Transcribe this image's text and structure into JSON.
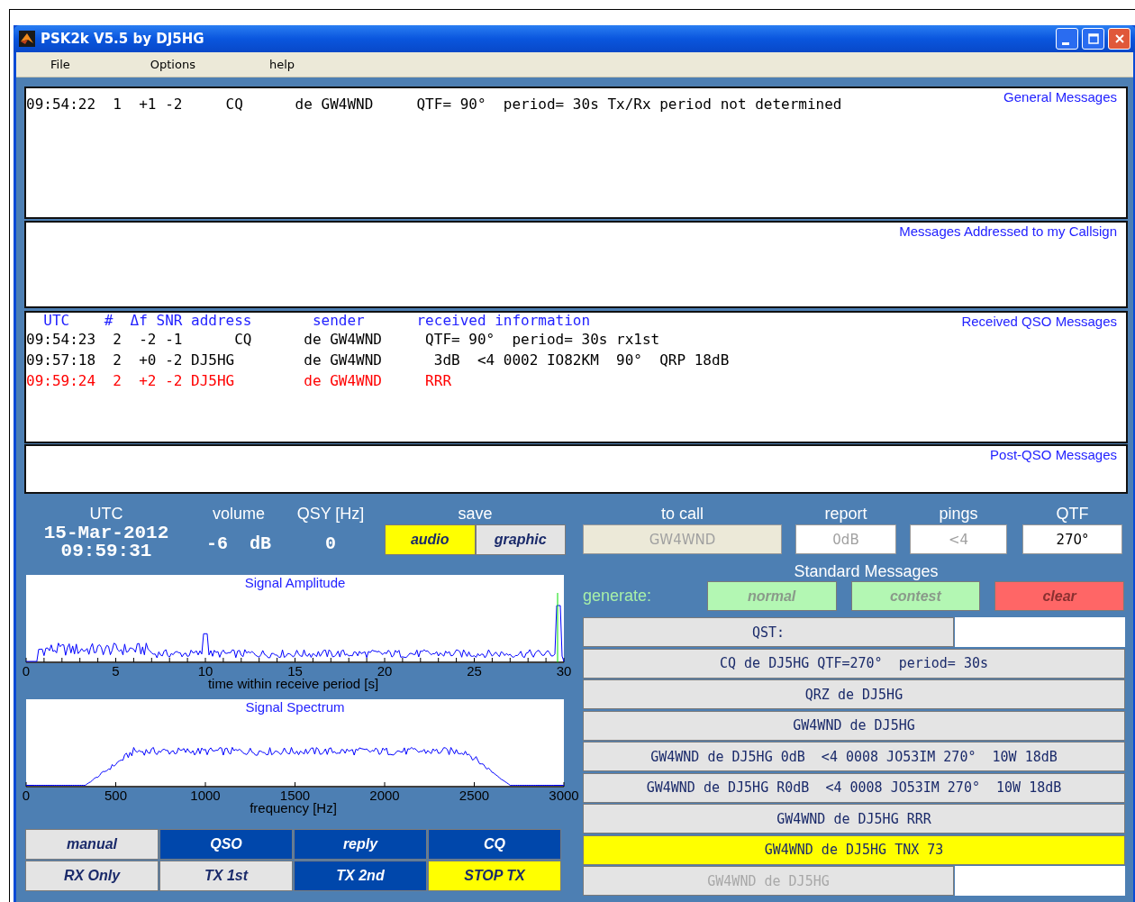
{
  "window": {
    "title": "PSK2k V5.5 by DJ5HG"
  },
  "menu": [
    {
      "label": "File"
    },
    {
      "label": "Options"
    },
    {
      "label": "help"
    }
  ],
  "message_panels": [
    {
      "title": "General Messages",
      "lines": [
        {
          "text": "09:54:22  1  +1 -2     CQ      de GW4WND     QTF= 90°  period= 30s Tx/Rx period not determined",
          "color": "#000000"
        }
      ]
    },
    {
      "title": "Messages Addressed to my Callsign"
    },
    {
      "title": "Received QSO Messages",
      "header": "  UTC    #  Δf SNR address       sender      received information",
      "lines": [
        {
          "text": "09:54:23  2  -2 -1      CQ      de GW4WND     QTF= 90°  period= 30s rx1st",
          "color": "#000000"
        },
        {
          "text": "09:57:18  2  +0 -2 DJ5HG        de GW4WND      3dB  <4 0002 IO82KM  90°  QRP 18dB",
          "color": "#000000"
        },
        {
          "text": "09:59:24  2  +2 -2 DJ5HG        de GW4WND     RRR",
          "color": "#ff0000"
        }
      ]
    },
    {
      "title": "Post-QSO Messages"
    }
  ],
  "clock": {
    "label": "UTC",
    "date": "15-Mar-2012",
    "time": "09:59:31"
  },
  "volume": {
    "label": "volume",
    "value": "-6  dB"
  },
  "qsy": {
    "label": "QSY [Hz]",
    "value": "0"
  },
  "save": {
    "label": "save",
    "buttons": [
      {
        "label": "audio",
        "selected": true
      },
      {
        "label": "graphic",
        "selected": false
      }
    ]
  },
  "amplitude_plot": {
    "title": "Signal Amplitude",
    "xlabel": "time within receive period [s]",
    "xticks": [
      "0",
      "5",
      "10",
      "15",
      "20",
      "25",
      "30"
    ]
  },
  "spectrum_plot": {
    "title": "Signal Spectrum",
    "xlabel": "frequency [Hz]",
    "xticks": [
      "0",
      "500",
      "1000",
      "1500",
      "2000",
      "2500",
      "3000"
    ]
  },
  "mode_buttons": [
    {
      "label": "manual",
      "kind": "toggle",
      "selected": false
    },
    {
      "label": "QSO",
      "kind": "toggle",
      "selected": true
    },
    {
      "label": "reply",
      "kind": "toggle",
      "selected": true
    },
    {
      "label": "CQ",
      "kind": "toggle",
      "selected": true
    },
    {
      "label": "RX Only",
      "kind": "toggle",
      "selected": false
    },
    {
      "label": "TX 1st",
      "kind": "toggle",
      "selected": false
    },
    {
      "label": "TX 2nd",
      "kind": "toggle",
      "selected": true
    },
    {
      "label": "STOP TX",
      "kind": "stop",
      "selected": false
    }
  ],
  "call_fields": [
    {
      "label": "to call",
      "value": "GW4WND",
      "kind": "readonly",
      "disabled": true
    },
    {
      "label": "report",
      "value": "0dB",
      "kind": "entry",
      "disabled": true
    },
    {
      "label": "pings",
      "value": "<4",
      "kind": "entry",
      "disabled": true
    },
    {
      "label": "QTF",
      "value": "270°",
      "kind": "entry",
      "disabled": false
    }
  ],
  "standard_messages": {
    "title": "Standard Messages",
    "generate_label": "generate:",
    "generate_buttons": [
      {
        "label": "normal",
        "kind": "generate"
      },
      {
        "label": "contest",
        "kind": "generate"
      },
      {
        "label": "clear",
        "kind": "clear"
      }
    ],
    "messages": [
      {
        "label": "QST:",
        "selected": false,
        "disabled": false,
        "field": true
      },
      {
        "label": "CQ de DJ5HG QTF=270°  period= 30s",
        "selected": false,
        "disabled": false,
        "field": false
      },
      {
        "label": "QRZ de DJ5HG",
        "selected": false,
        "disabled": false,
        "field": false
      },
      {
        "label": "GW4WND de DJ5HG",
        "selected": false,
        "disabled": false,
        "field": false
      },
      {
        "label": "GW4WND de DJ5HG 0dB  <4 0008 JO53IM 270°  10W 18dB",
        "selected": false,
        "disabled": false,
        "field": false
      },
      {
        "label": "GW4WND de DJ5HG R0dB  <4 0008 JO53IM 270°  10W 18dB",
        "selected": false,
        "disabled": false,
        "field": false
      },
      {
        "label": "GW4WND de DJ5HG RRR",
        "selected": false,
        "disabled": false,
        "field": false
      },
      {
        "label": "GW4WND de DJ5HG TNX 73",
        "selected": true,
        "disabled": false,
        "field": false
      },
      {
        "label": "GW4WND de DJ5HG",
        "selected": false,
        "disabled": true,
        "field": true
      }
    ]
  }
}
